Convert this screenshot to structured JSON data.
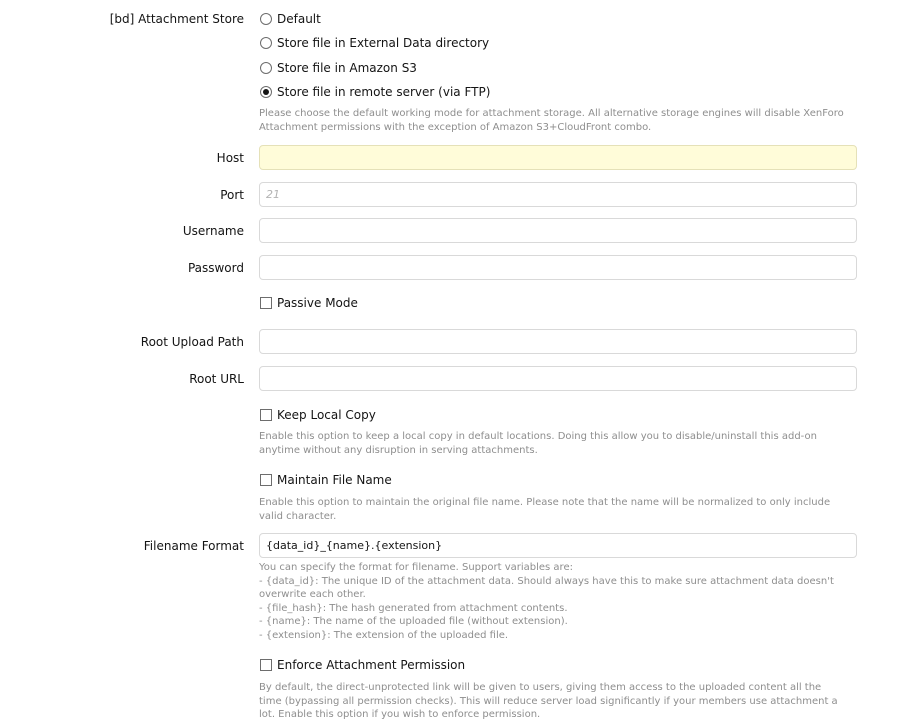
{
  "attachment_store": {
    "label": "[bd] Attachment Store",
    "options": [
      {
        "label": "Default",
        "selected": false
      },
      {
        "label": "Store file in External Data directory",
        "selected": false
      },
      {
        "label": "Store file in Amazon S3",
        "selected": false
      },
      {
        "label": "Store file in remote server (via FTP)",
        "selected": true
      }
    ],
    "hint": "Please choose the default working mode for attachment storage. All alternative storage engines will disable XenForo\nAttachment permissions with the exception of Amazon S3+CloudFront combo."
  },
  "host": {
    "label": "Host",
    "value": "",
    "placeholder": ""
  },
  "port": {
    "label": "Port",
    "value": "",
    "placeholder": "21"
  },
  "username": {
    "label": "Username",
    "value": ""
  },
  "password": {
    "label": "Password",
    "value": ""
  },
  "passive_mode": {
    "label": "Passive Mode",
    "checked": false
  },
  "root_upload_path": {
    "label": "Root Upload Path",
    "value": ""
  },
  "root_url": {
    "label": "Root URL",
    "value": ""
  },
  "keep_local_copy": {
    "label": "Keep Local Copy",
    "checked": false,
    "hint": "Enable this option to keep a local copy in default locations. Doing this allow you to disable/uninstall this add-on\nanytime without any disruption in serving attachments."
  },
  "maintain_file_name": {
    "label": "Maintain File Name",
    "checked": false,
    "hint": "Enable this option to maintain the original file name. Please note that the name will be normalized to only include\nvalid character."
  },
  "filename_format": {
    "label": "Filename Format",
    "value": "{data_id}_{name}.{extension}",
    "hint": "You can specify the format for filename. Support variables are:\n- {data_id}: The unique ID of the attachment data. Should always have this to make sure attachment data doesn't\noverwrite each other.\n- {file_hash}: The hash generated from attachment contents.\n- {name}: The name of the uploaded file (without extension).\n- {extension}: The extension of the uploaded file."
  },
  "enforce_permission": {
    "label": "Enforce Attachment Permission",
    "checked": false,
    "hint": "By default, the direct-unprotected link will be given to users, giving them access to the uploaded content all the\ntime (bypassing all permission checks). This will reduce server load significantly if your members use attachment a\nlot. Enable this option if you wish to enforce permission."
  },
  "colors": {
    "focus_bg": "#fffcd9",
    "hint_text": "#8e8e8e",
    "border": "#d9d9d9"
  }
}
